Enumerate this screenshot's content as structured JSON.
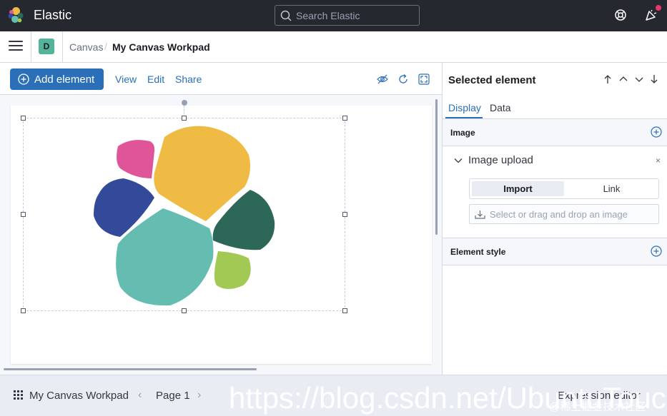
{
  "header": {
    "app_title": "Elastic",
    "search_placeholder": "Search Elastic",
    "logo_icon": "elastic-logo-icon",
    "help_icon": "help-lifebuoy-icon",
    "news_icon": "newsfeed-icon",
    "notification_color": "#e7386d"
  },
  "nav": {
    "space_initial": "D",
    "space_color": "#54b399",
    "breadcrumbs": [
      "Canvas",
      "My Canvas Workpad"
    ],
    "breadcrumb_separator": "/"
  },
  "toolbar": {
    "add_label": "Add element",
    "links": [
      "View",
      "Edit",
      "Share"
    ],
    "icons": [
      "hide-icon",
      "refresh-icon",
      "fullscreen-icon"
    ],
    "accent": "#2a6fb8"
  },
  "canvas": {
    "element": "elastic-logo-image",
    "logo_colors": [
      "#e0559a",
      "#f0bb44",
      "#33499a",
      "#2c6757",
      "#65bdb2",
      "#a1c953"
    ]
  },
  "footer": {
    "workpad_name": "My Canvas Workpad",
    "page_label": "Page 1",
    "expression_editor": "Expression editor",
    "watermark": "https://blog.csdn.net/UbuntuTouch",
    "watermark_sub": "@稀土掘金技术社区"
  },
  "sidebar": {
    "title": "Selected element",
    "tabs": [
      "Display",
      "Data"
    ],
    "active_tab": "Display",
    "image_section": "Image",
    "image_upload_label": "Image upload",
    "close_glyph": "×",
    "mode_options": [
      "Import",
      "Link"
    ],
    "active_mode": "Import",
    "drop_placeholder": "Select or drag and drop an image",
    "style_section": "Element style"
  }
}
